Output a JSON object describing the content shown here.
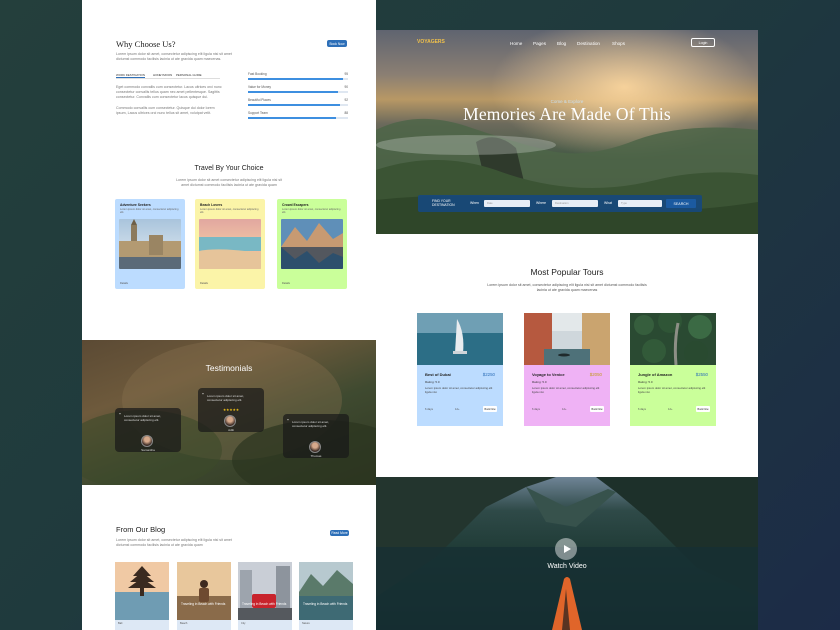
{
  "left": {
    "why": {
      "title": "Why Choose Us?",
      "button": "Book Now",
      "desc": "Lorem ipsum dolor sit amet, consectetur adipiscing elit ligula nisi sit amet dictumst commodo facilisis lacinia ut ate gravida quam maecenas.",
      "tabs": [
        "WORK DESTINATION",
        "HONEYMOON",
        "PERSONAL GUIDE"
      ],
      "para1": "Eget commodo convallis cum consectetur. Lacus ultrices orci nunc consectetur convallis tellus quam nec amet pellentesque. Sagittis consectetur. Convallis cum consectetur lacus quisque dui.",
      "para2": "Commodo convallis cum consectetur. Quisque dui dolor lorem ipsum, Lacus ultrices orci nunc tellus sit amet, volutpat velit.",
      "progress": [
        {
          "label": "Fast Booking",
          "value": 95
        },
        {
          "label": "Value for Money",
          "value": 90
        },
        {
          "label": "Beautiful Places",
          "value": 92
        },
        {
          "label": "Support Team",
          "value": 88
        }
      ]
    },
    "travel": {
      "title": "Travel By Your Choice",
      "desc": "Lorem ipsum dolor sit amet consectetur adipiscing elit ligula nisi sit amet dictumst commodo facilisis lacinia ut ate gravida quam",
      "cards": [
        {
          "title": "Adventure Seekers",
          "desc": "Lorem ipsum dolor sit amet, consectetur adipiscing elit.",
          "foot": "Details"
        },
        {
          "title": "Beach Lovers",
          "desc": "Lorem ipsum dolor sit amet, consectetur adipiscing elit.",
          "foot": "Details"
        },
        {
          "title": "Crowd Escapers",
          "desc": "Lorem ipsum dolor sit amet, consectetur adipiscing elit.",
          "foot": "Details"
        }
      ]
    },
    "testimonials": {
      "title": "Testimonials",
      "cards": [
        {
          "text": "Lorem ipsum dolor sit amet, consectetur adipiscing elit.",
          "name": "Samantha"
        },
        {
          "text": "Lorem ipsum dolor sit amet, consectetur adipiscing elit.",
          "name": "Aditi"
        },
        {
          "text": "Lorem ipsum dolor sit amet, consectetur adipiscing elit.",
          "name": "Thomas"
        }
      ]
    },
    "blog": {
      "title": "From Our Blog",
      "button": "Read More",
      "desc": "Lorem ipsum dolor sit amet, consectetur adipiscing elit ligula nisi sit amet dictumst commodo facilisis lacinia ut ate gravida quam",
      "posts": [
        {
          "title": "",
          "foot": "Bali"
        },
        {
          "title": "Traveling in Beach with Friends",
          "foot": "Beach"
        },
        {
          "title": "Traveling in Beach with Friends",
          "foot": "City"
        },
        {
          "title": "Traveling in Beach with Friends",
          "foot": "Nature"
        }
      ]
    }
  },
  "right": {
    "brand": "VOYAGERS",
    "nav": [
      "Home",
      "Pages",
      "Blog",
      "Destination",
      "Shops"
    ],
    "login": "Login",
    "hero": {
      "subtitle": "Come & Explore",
      "title": "Memories Are Made Of This"
    },
    "search": {
      "label": "FIND YOUR DESTINATION",
      "when_label": "When",
      "when_placeholder": "Date",
      "where_label": "Where",
      "where_placeholder": "Destination",
      "what_label": "What",
      "what_placeholder": "Type",
      "button": "SEARCH"
    },
    "popular": {
      "title": "Most Popular Tours",
      "desc": "Lorem ipsum dolor sit amet, consectetur adipiscing elit ligula nisi sit amet dictumst commodo facilisis lacinia ut ate gravida quam maecenas",
      "tours": [
        {
          "name": "Best of Dubai",
          "price": "$2250",
          "rating": "Rating: 5.0",
          "desc": "Lorem ipsum dolor sit amet, consectetur adipiscing elit ligula nisi.",
          "days": "6 days",
          "people": "12+",
          "button": "Book Now"
        },
        {
          "name": "Voyage to Venice",
          "price": "$2050",
          "rating": "Rating: 5.0",
          "desc": "Lorem ipsum dolor sit amet, consectetur adipiscing elit ligula nisi.",
          "days": "6 days",
          "people": "12+",
          "button": "Book Now"
        },
        {
          "name": "Jungle of Amazon",
          "price": "$2550",
          "rating": "Rating: 5.0",
          "desc": "Lorem ipsum dolor sit amet, consectetur adipiscing elit ligula nisi.",
          "days": "6 days",
          "people": "12+",
          "button": "Book Now"
        }
      ]
    },
    "video": {
      "label": "Watch Video"
    }
  },
  "colors": {
    "accent": "#2d6fb8",
    "card_blue": "#bcdcff",
    "card_yellow": "#fbf4a8",
    "card_green": "#caff9a",
    "card_pink": "#efb2f5"
  }
}
